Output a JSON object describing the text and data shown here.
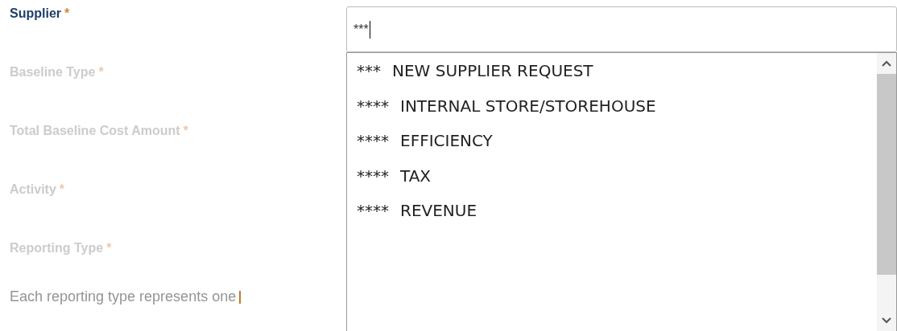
{
  "fields": [
    {
      "label": "Supplier",
      "required_mark": "*",
      "disabled": false
    },
    {
      "label": "Baseline Type",
      "required_mark": "*",
      "disabled": true
    },
    {
      "label": "Total Baseline Cost Amount",
      "required_mark": "*",
      "disabled": true
    },
    {
      "label": "Activity",
      "required_mark": "*",
      "disabled": true
    },
    {
      "label": "Reporting Type",
      "required_mark": "*",
      "disabled": true
    }
  ],
  "help_text": "Each reporting type represents one",
  "supplier_input": {
    "value": "***"
  },
  "suggestions": [
    {
      "prefix": "***",
      "label": "NEW SUPPLIER REQUEST"
    },
    {
      "prefix": "****",
      "label": "INTERNAL STORE/STOREHOUSE"
    },
    {
      "prefix": "****",
      "label": "EFFICIENCY"
    },
    {
      "prefix": "****",
      "label": "TAX"
    },
    {
      "prefix": "****",
      "label": "REVENUE"
    }
  ]
}
